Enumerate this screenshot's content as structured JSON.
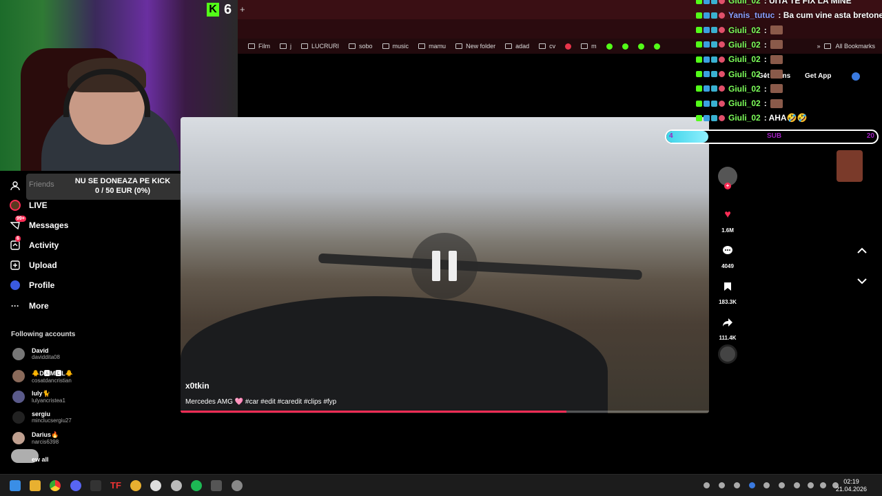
{
  "kick": {
    "viewers": "6"
  },
  "browser": {
    "new_tab": "+",
    "bookmarks": [
      "Film",
      "j",
      "LUCRURI",
      "sobo",
      "music",
      "mamu",
      "New folder",
      "adad",
      "cv",
      "m"
    ],
    "all_bookmarks": "All Bookmarks",
    "overflow": "»"
  },
  "donation": {
    "line1": "NU SE DONEAZA PE KICK",
    "line2": "0 / 50 EUR (0%)"
  },
  "sidebar": {
    "friends": "Friends",
    "items": [
      {
        "label": "LIVE",
        "icon": "live-icon"
      },
      {
        "label": "Messages",
        "icon": "messages-icon",
        "badge": "99+"
      },
      {
        "label": "Activity",
        "icon": "activity-icon",
        "badge": "6"
      },
      {
        "label": "Upload",
        "icon": "upload-icon"
      },
      {
        "label": "Profile",
        "icon": "profile-icon"
      },
      {
        "label": "More",
        "icon": "more-icon"
      }
    ],
    "following_title": "Following accounts",
    "accounts": [
      {
        "name": "David",
        "handle": "daviddita08"
      },
      {
        "name": "🐥D🅰M🅴L🐥",
        "handle": "cosatdancristian"
      },
      {
        "name": "luly🐈",
        "handle": "lulyancristea1"
      },
      {
        "name": "sergiu",
        "handle": "minclucsergiu27"
      },
      {
        "name": "Darius🔥",
        "handle": "narcis6398"
      }
    ],
    "see_all": "ew all"
  },
  "video": {
    "author": "x0tkin",
    "description": "Mercedes AMG 🩷 #car #edit #caredit #clips #fyp",
    "progress": 0.73
  },
  "actions": {
    "likes": "1.6M",
    "comments": "4049",
    "saves": "183.3K",
    "shares": "111.4K"
  },
  "header": {
    "get_coins": "Get Coins",
    "get_app": "Get App"
  },
  "chat": [
    {
      "user": "Giuli_02",
      "text": ": UITA TE FIX LA MINE",
      "color": "#7dff5a"
    },
    {
      "user": "Yanis_tutuc",
      "text": ": Ba cum vine asta bretonel cu c",
      "color": "#8aa0ff"
    },
    {
      "user": "Giuli_02",
      "text": ":",
      "color": "#7dff5a"
    },
    {
      "user": "Giuli_02",
      "text": ":",
      "color": "#7dff5a"
    },
    {
      "user": "Giuli_02",
      "text": ":",
      "color": "#7dff5a"
    },
    {
      "user": "Giuli_02",
      "text": ":",
      "color": "#7dff5a"
    },
    {
      "user": "Giuli_02",
      "text": ":",
      "color": "#7dff5a"
    },
    {
      "user": "Giuli_02",
      "text": ":",
      "color": "#7dff5a"
    },
    {
      "user": "Giuli_02",
      "text": ": AHA🤣🤣",
      "color": "#7dff5a"
    }
  ],
  "subgoal": {
    "current": "4",
    "label": "SUB",
    "target": "20",
    "fraction": 0.2
  },
  "taskbar": {
    "time": "02:19",
    "date": "21.04.2026"
  }
}
